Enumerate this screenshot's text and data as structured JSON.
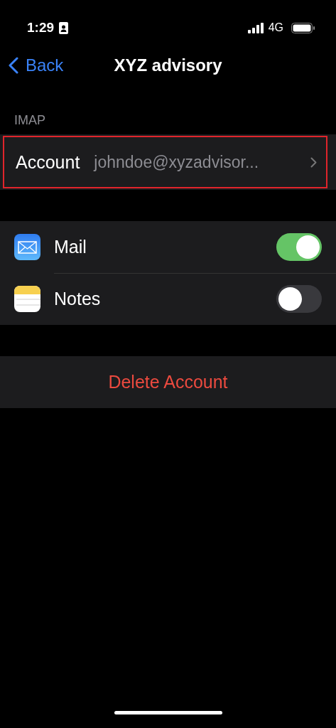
{
  "status_bar": {
    "time": "1:29",
    "network": "4G"
  },
  "nav": {
    "back": "Back",
    "title": "XYZ advisory"
  },
  "section": {
    "header": "IMAP",
    "account": {
      "label": "Account",
      "value": "johndoe@xyzadvisor...",
      "highlighted": true
    }
  },
  "apps": [
    {
      "kind": "mail",
      "label": "Mail",
      "on": true
    },
    {
      "kind": "notes",
      "label": "Notes",
      "on": false
    }
  ],
  "delete_button": "Delete Account"
}
